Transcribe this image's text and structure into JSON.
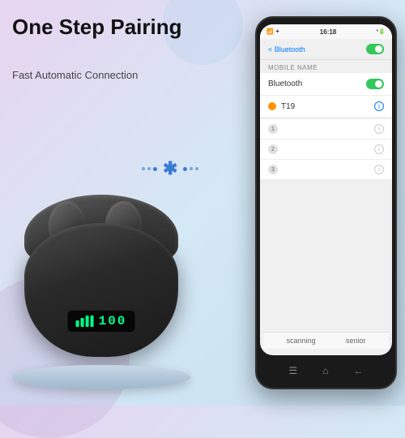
{
  "headline": "One Step Pairing",
  "subheadline": "Fast Automatic Connection",
  "bluetooth": {
    "header_title": "Bluetooth",
    "back_label": "< Bluetooth",
    "mobile_name_label": "Mobile Name",
    "bluetooth_label": "Bluetooth",
    "device_t19": "T19",
    "scanning": "scanning",
    "senior": "senior",
    "status_time": "16:18",
    "status_signal": "📶",
    "other_devices": [
      "",
      "",
      ""
    ]
  },
  "led": {
    "text": "100"
  },
  "icons": {
    "bluetooth": "ᛒ",
    "info": "ⓘ",
    "chevron_left": "‹",
    "nav_home": "⌂",
    "nav_back": "←",
    "nav_menu": "☰"
  }
}
